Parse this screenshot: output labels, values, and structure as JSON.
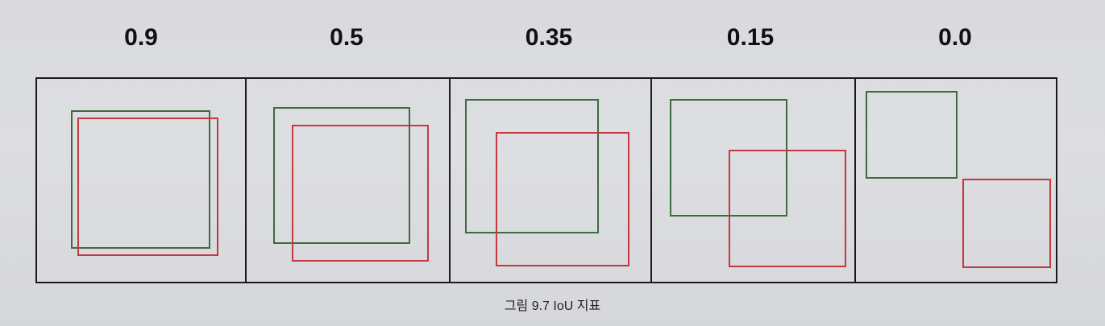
{
  "panels": [
    {
      "iou_label": "0.9"
    },
    {
      "iou_label": "0.5"
    },
    {
      "iou_label": "0.35"
    },
    {
      "iou_label": "0.15"
    },
    {
      "iou_label": "0.0"
    }
  ],
  "caption": "그림 9.7 IoU 지표",
  "colors": {
    "ground_truth_box": "#3c6b3c",
    "predicted_box": "#c23a3f",
    "frame": "#1a1a1a"
  }
}
